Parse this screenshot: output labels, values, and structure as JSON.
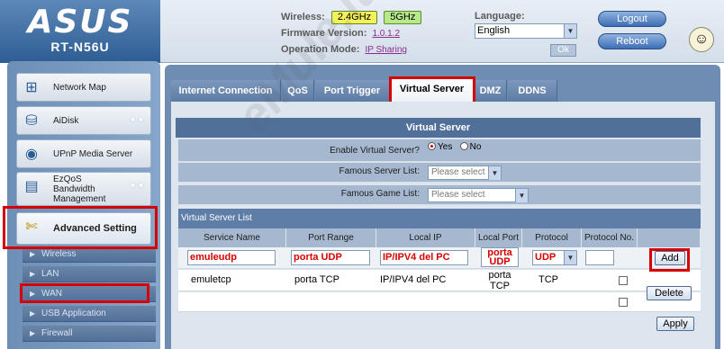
{
  "header": {
    "logo": "ASUS",
    "model": "RT-N56U",
    "wireless_label": "Wireless:",
    "band_24": "2.4GHz",
    "band_5": "5GHz",
    "firmware_label": "Firmware Version:",
    "firmware_value": "1.0.1.2",
    "opmode_label": "Operation Mode:",
    "opmode_value": "IP Sharing",
    "language_label": "Language:",
    "language_value": "English",
    "ok_label": "Ok",
    "logout_label": "Logout",
    "reboot_label": "Reboot"
  },
  "menu": {
    "items": [
      {
        "label": "Network Map",
        "icon": "network-map-icon"
      },
      {
        "label": "AiDisk",
        "icon": "aidisk-icon"
      },
      {
        "label": "UPnP Media Server",
        "icon": "upnp-icon"
      },
      {
        "label": "EzQoS Bandwidth Management",
        "icon": "ezqos-icon"
      },
      {
        "label": "Advanced Setting",
        "icon": "tools-icon"
      }
    ],
    "sub_items": [
      "Wireless",
      "LAN",
      "WAN",
      "USB Application",
      "Firewall"
    ]
  },
  "tabs": [
    "Internet Connection",
    "QoS",
    "Port Trigger",
    "Virtual Server",
    "DMZ",
    "DDNS"
  ],
  "active_tab": "Virtual Server",
  "form": {
    "title": "Virtual Server",
    "enable_label": "Enable Virtual Server?",
    "yes_label": "Yes",
    "no_label": "No",
    "enable_value": "Yes",
    "famous_server_label": "Famous Server List:",
    "famous_server_placeholder": "Please select",
    "famous_game_label": "Famous Game List:",
    "famous_game_placeholder": "Please select"
  },
  "list": {
    "title": "Virtual Server List",
    "columns": [
      "Service Name",
      "Port Range",
      "Local IP",
      "Local Port",
      "Protocol",
      "Protocol No."
    ],
    "new_entry": {
      "service_name": "emuleudp",
      "port_range": "porta UDP",
      "local_ip": "IP/IPV4 del PC",
      "local_port_1": "porta",
      "local_port_2": "UDP",
      "protocol": "UDP",
      "protocol_no": ""
    },
    "rows": [
      {
        "service_name": "emuletcp",
        "port_range": "porta TCP",
        "local_ip": "IP/IPV4 del PC",
        "local_port_1": "porta",
        "local_port_2": "TCP",
        "protocol": "TCP",
        "protocol_no": ""
      }
    ],
    "add_label": "Add",
    "delete_label": "Delete",
    "apply_label": "Apply"
  },
  "watermark": "eMule.it",
  "colors": {
    "highlight_red": "#d60000",
    "header_blue": "#50709a",
    "band_24_yellow": "#f4f15b",
    "band_5_green": "#b7e88a"
  }
}
